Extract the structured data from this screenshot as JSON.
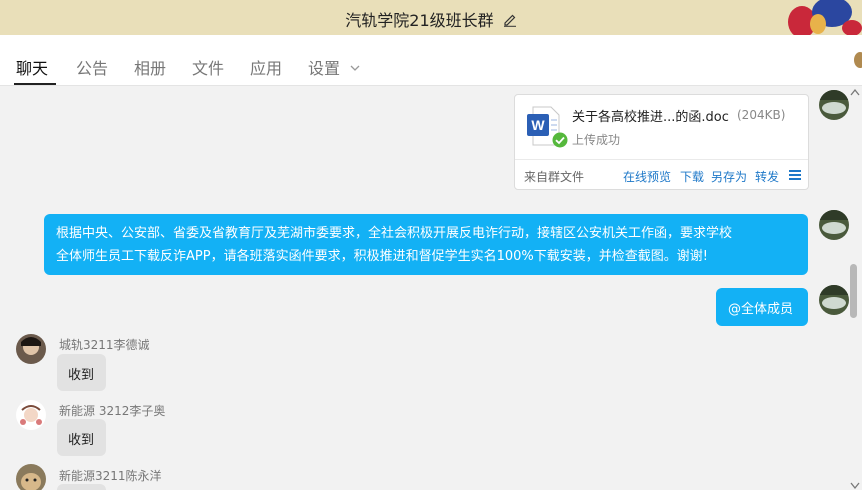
{
  "window": {
    "title": "汽轨学院21级班长群"
  },
  "tabs": [
    {
      "label": "聊天",
      "active": true
    },
    {
      "label": "公告"
    },
    {
      "label": "相册"
    },
    {
      "label": "文件"
    },
    {
      "label": "应用"
    },
    {
      "label": "设置"
    }
  ],
  "messages": {
    "file": {
      "name": "关于各高校推进...的函.doc",
      "size": "(204KB)",
      "status": "上传成功",
      "source": "来自群文件",
      "actions": [
        "在线预览",
        "下载",
        "另存为",
        "转发"
      ]
    },
    "notice": {
      "line1": "根据中央、公安部、省委及省教育厅及芜湖市委要求，全社会积极开展反电诈行动，接辖区公安机关工作函，要求学校",
      "line2": "全体师生员工下载反诈APP，请各班落实函件要求，积极推进和督促学生实名100%下载安装，并检查截图。谢谢!"
    },
    "mention": "@全体成员",
    "replies": [
      {
        "sender": "城轨3211李德诚",
        "text": "收到"
      },
      {
        "sender": "新能源 3212李子奥",
        "text": "收到"
      },
      {
        "sender": "新能源3211陈永洋",
        "text": ""
      }
    ]
  },
  "colors": {
    "title_bar": "#e9dfb9",
    "accent_bubble": "#13b1f5",
    "link": "#1e78c8",
    "word_icon": "#2b5fb5",
    "success": "#55b83c"
  }
}
